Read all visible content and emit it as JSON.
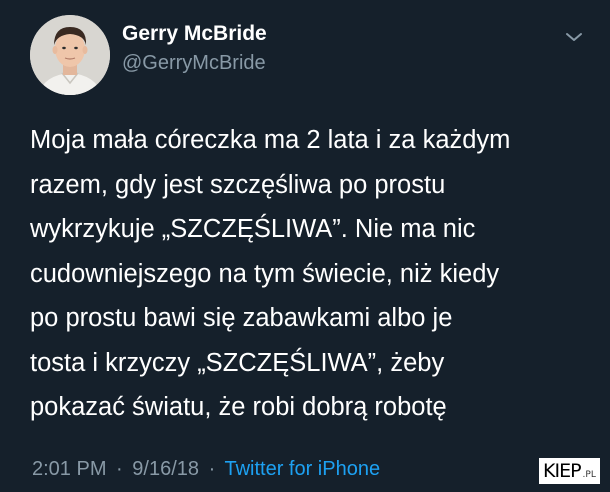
{
  "author": {
    "name": "Gerry McBride",
    "handle": "@GerryMcBride"
  },
  "tweet": {
    "lines": [
      "Moja mała córeczka  ma 2 lata i za każdym",
      "razem, gdy jest szczęśliwa po prostu",
      "wykrzykuje „SZCZĘŚLIWA”. Nie ma nic",
      "cudowniejszego na tym świecie, niż kiedy",
      "po prostu bawi się zabawkami albo je",
      "tosta i krzyczy „SZCZĘŚLIWA”, żeby",
      "pokazać światu, że robi dobrą robotę"
    ]
  },
  "meta": {
    "time": "2:01 PM",
    "separator": "·",
    "date": "9/16/18",
    "source": "Twitter for iPhone"
  },
  "watermark": {
    "main": "KIEP",
    "suffix": ".PL"
  },
  "icons": {
    "menu": "chevron-down-icon",
    "avatar": "profile-photo"
  },
  "colors": {
    "background": "#15202b",
    "secondary_text": "#8899a6",
    "link": "#1da1f2",
    "primary_text": "#ffffff"
  }
}
